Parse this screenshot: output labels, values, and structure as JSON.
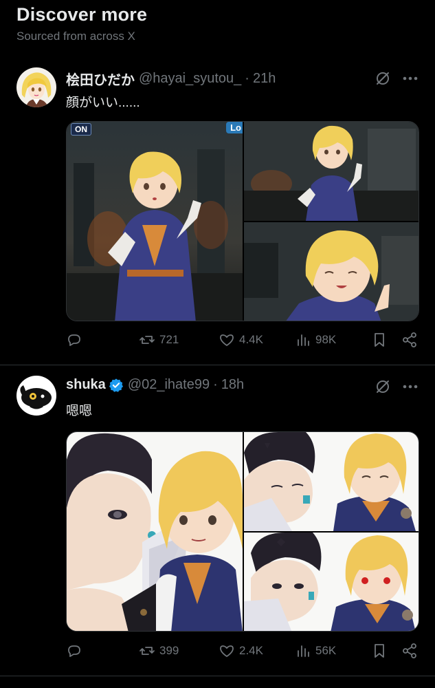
{
  "section": {
    "title": "Discover more",
    "subtitle": "Sourced from across X"
  },
  "posts": [
    {
      "display_name": "桧田ひだか",
      "handle": "@hayai_syutou_",
      "separator": "·",
      "time": "21h",
      "verified": false,
      "text": "顔がいい......",
      "media_badges": {
        "left": "ON",
        "right": "Lo"
      },
      "stats": {
        "reposts": "721",
        "likes": "4.4K",
        "views": "98K"
      }
    },
    {
      "display_name": "shuka",
      "handle": "@02_ihate99",
      "separator": "·",
      "time": "18h",
      "verified": true,
      "text": "嗯嗯",
      "stats": {
        "reposts": "399",
        "likes": "2.4K",
        "views": "56K"
      }
    }
  ],
  "icons": {
    "reply": "reply-icon",
    "repost": "repost-icon",
    "like": "heart-icon",
    "views": "views-icon",
    "bookmark": "bookmark-icon",
    "share": "share-icon",
    "grok": "grok-icon",
    "more": "more-icon",
    "verified": "verified-badge-icon"
  },
  "colors": {
    "background": "#000000",
    "text_primary": "#e7e9ea",
    "text_secondary": "#71767b",
    "divider": "#2f3336",
    "verified": "#1d9bf0"
  }
}
